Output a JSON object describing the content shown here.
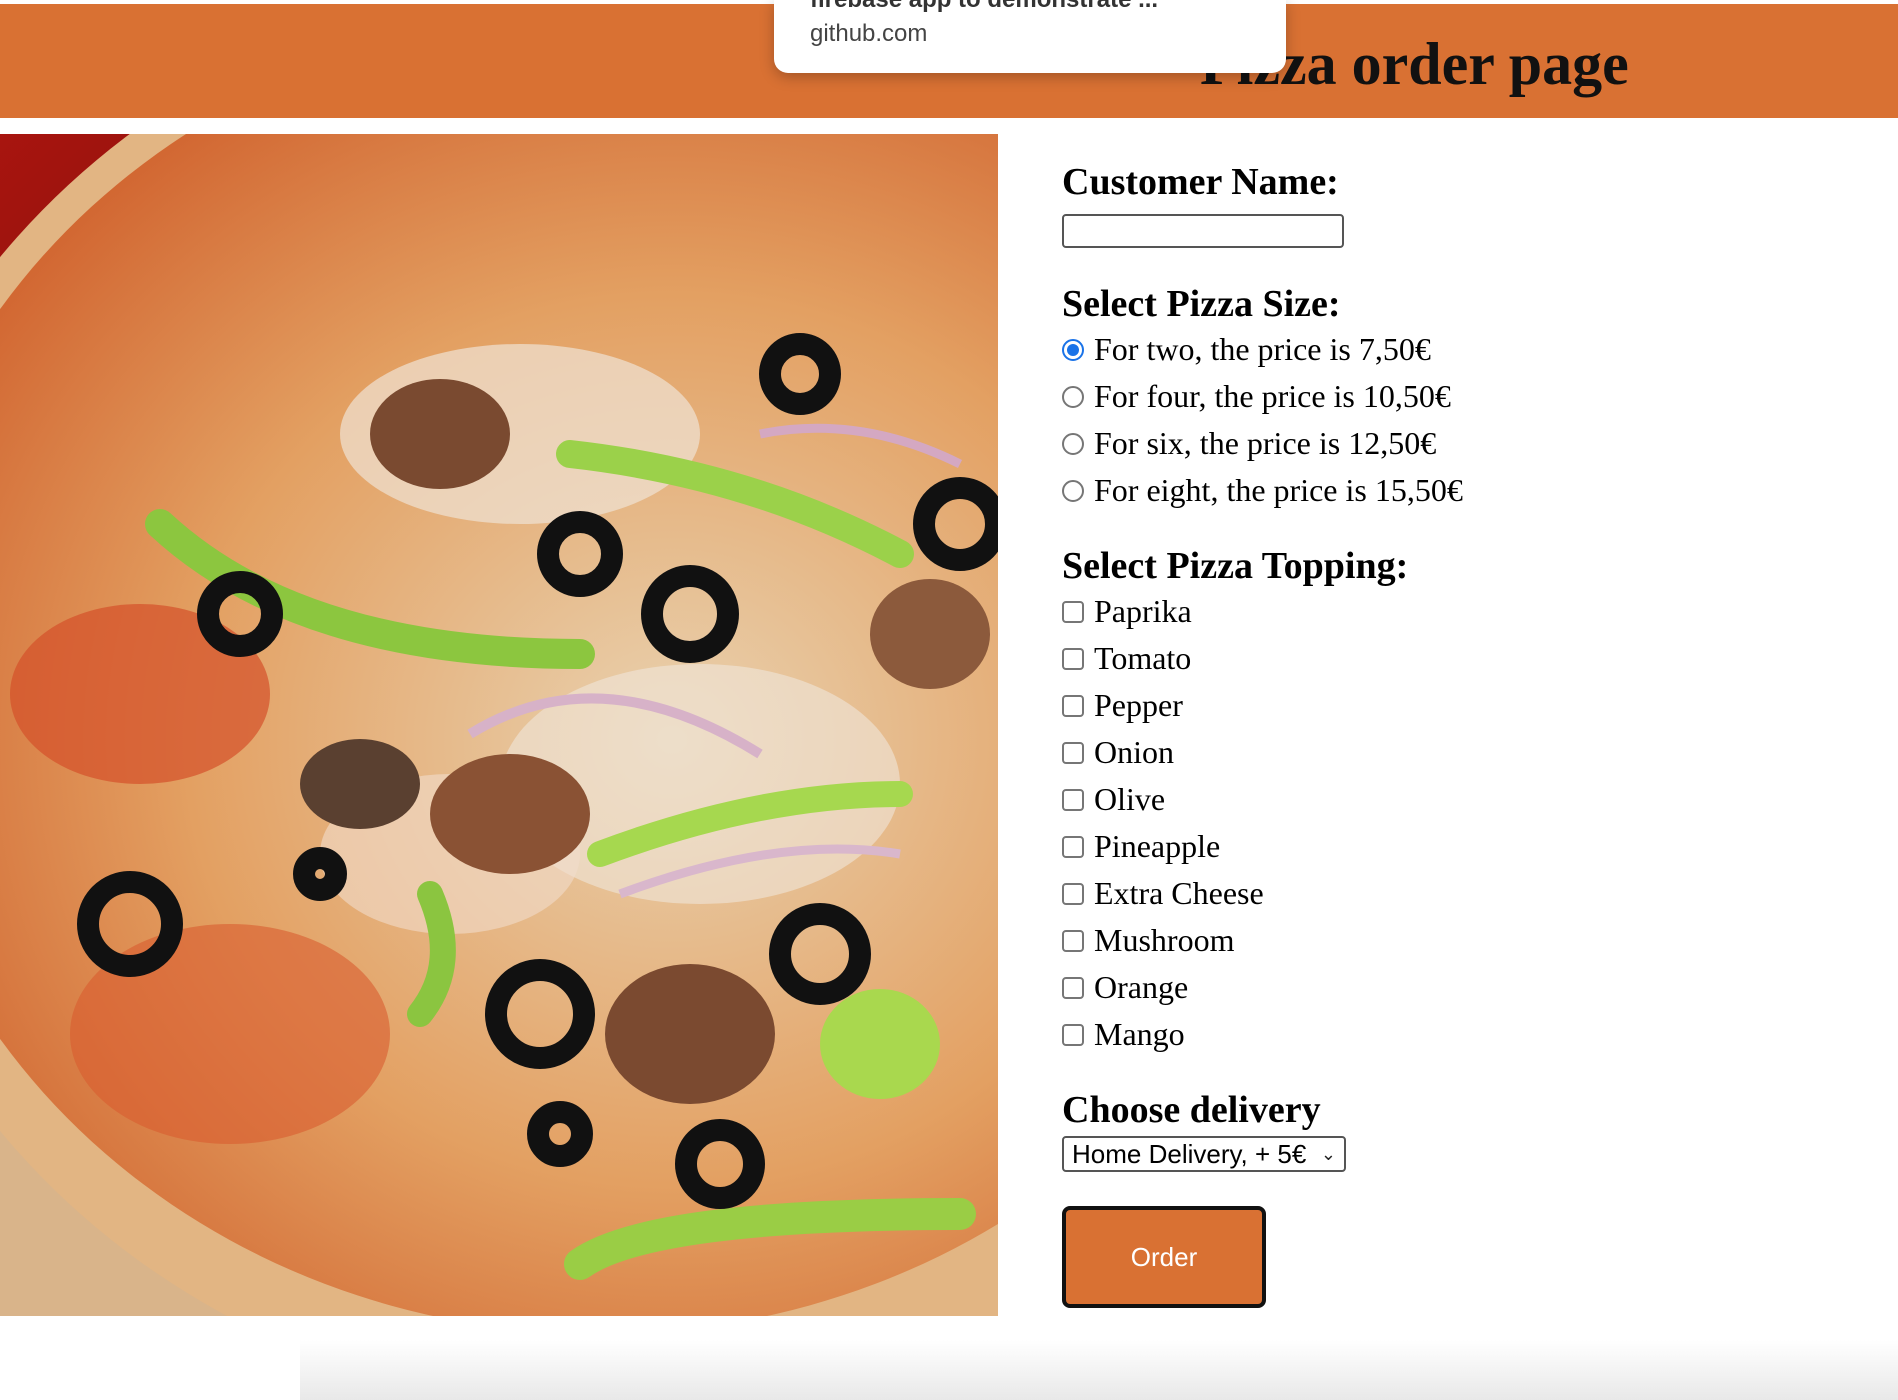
{
  "header": {
    "title": "Pizza order page"
  },
  "tooltip": {
    "title": "firebase app to demonstrate ...",
    "url": "github.com"
  },
  "image": {
    "alt": "pizza-photo"
  },
  "form": {
    "name_label": "Customer Name:",
    "name_value": "",
    "size_label": "Select Pizza Size:",
    "sizes": [
      {
        "label": "For two, the price is 7,50€",
        "checked": true
      },
      {
        "label": "For four, the price is 10,50€",
        "checked": false
      },
      {
        "label": "For six, the price is 12,50€",
        "checked": false
      },
      {
        "label": "For eight, the price is 15,50€",
        "checked": false
      }
    ],
    "topping_label": "Select Pizza Topping:",
    "toppings": [
      {
        "label": "Paprika",
        "checked": false
      },
      {
        "label": "Tomato",
        "checked": false
      },
      {
        "label": "Pepper",
        "checked": false
      },
      {
        "label": "Onion",
        "checked": false
      },
      {
        "label": "Olive",
        "checked": false
      },
      {
        "label": "Pineapple",
        "checked": false
      },
      {
        "label": "Extra Cheese",
        "checked": false
      },
      {
        "label": "Mushroom",
        "checked": false
      },
      {
        "label": "Orange",
        "checked": false
      },
      {
        "label": "Mango",
        "checked": false
      }
    ],
    "delivery_label": "Choose delivery",
    "delivery_selected": "Home Delivery, + 5€",
    "order_label": "Order"
  },
  "colors": {
    "brand": "#d97133",
    "radio_accent": "#1a73e8"
  }
}
